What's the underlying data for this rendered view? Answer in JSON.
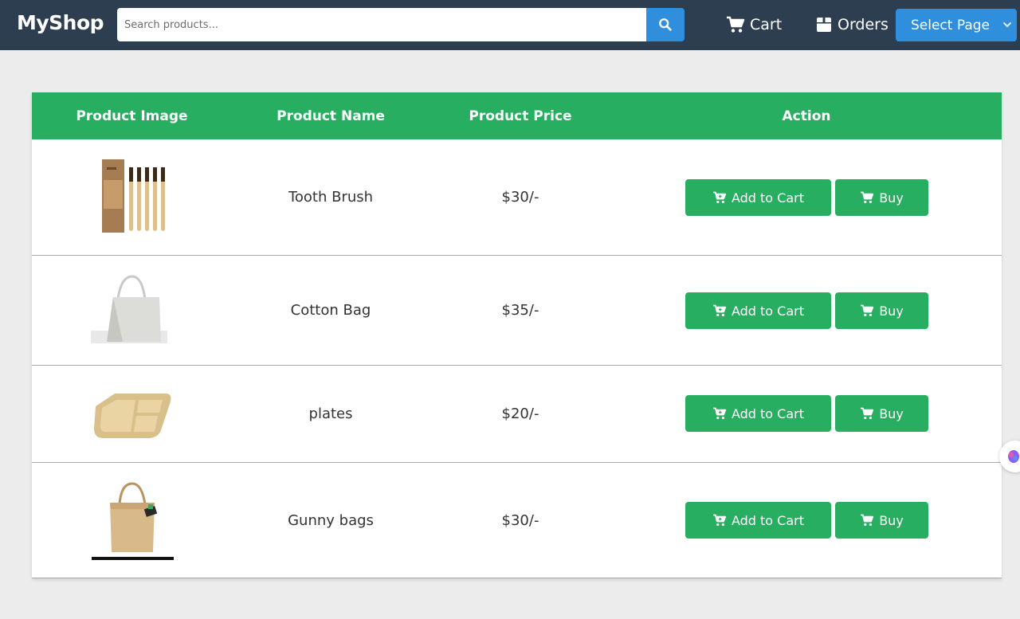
{
  "navbar": {
    "brand": "MyShop",
    "search_placeholder": "Search products...",
    "cart_label": "Cart",
    "orders_label": "Orders",
    "select_page_label": "Select Page"
  },
  "table": {
    "headers": [
      "Product Image",
      "Product Name",
      "Product Price",
      "Action"
    ],
    "add_to_cart_label": "Add to Cart",
    "buy_label": "Buy",
    "rows": [
      {
        "name": "Tooth Brush",
        "price": "$30/-"
      },
      {
        "name": "Cotton Bag",
        "price": "$35/-"
      },
      {
        "name": "plates",
        "price": "$20/-"
      },
      {
        "name": "Gunny bags",
        "price": "$30/-"
      }
    ]
  },
  "colors": {
    "navbar": "#2c3e50",
    "accent_blue": "#2f8fdc",
    "accent_green": "#27ae60",
    "page_bg": "#ececec"
  }
}
